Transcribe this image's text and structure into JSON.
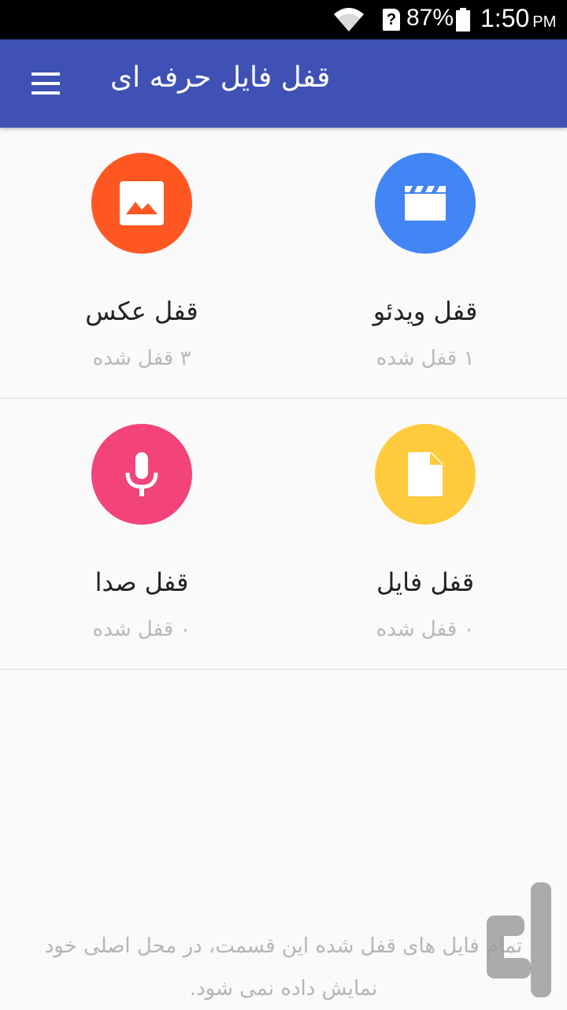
{
  "status_bar": {
    "battery_percent": "87%",
    "time": "1:50",
    "time_suffix": "PM",
    "icons": [
      "wifi-icon",
      "sim-unknown-icon",
      "battery-icon"
    ]
  },
  "app_bar": {
    "title": "قفل فایل حرفه ای",
    "menu_icon": "hamburger-menu-icon"
  },
  "tiles": [
    {
      "label": "قفل ویدئو",
      "count": "۱ قفل شده",
      "icon": "video-clapper-icon",
      "color": "#4285f4"
    },
    {
      "label": "قفل عکس",
      "count": "۳ قفل شده",
      "icon": "image-icon",
      "color": "#ff5722"
    },
    {
      "label": "قفل فایل",
      "count": "۰ قفل شده",
      "icon": "file-icon",
      "color": "#ffcb3d"
    },
    {
      "label": "قفل صدا",
      "count": "۰ قفل شده",
      "icon": "microphone-icon",
      "color": "#f2447a"
    }
  ],
  "footer_note": "تمام فایل های قفل شده این قسمت، در محل اصلی خود نمایش داده نمی شود.",
  "colors": {
    "app_bar": "#3f51b5",
    "background": "#fafafa"
  }
}
